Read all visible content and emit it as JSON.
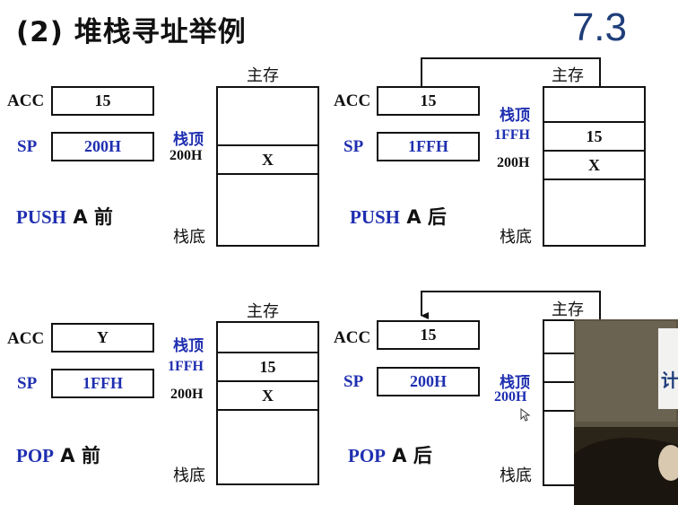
{
  "header": {
    "title": "(2) 堆栈寻址举例",
    "section": "7.3"
  },
  "labels": {
    "acc": "ACC",
    "sp": "SP",
    "main_memory": "主存",
    "stack_top": "栈顶",
    "stack_bottom": "栈底"
  },
  "panels": {
    "push_before": {
      "acc_value": "15",
      "sp_value": "200H",
      "cells": [
        "X"
      ],
      "addresses": [
        "200H"
      ],
      "caption_op": "PUSH",
      "caption_rest": " A 前"
    },
    "push_after": {
      "acc_value": "15",
      "sp_value": "1FFH",
      "cells": [
        "15",
        "X"
      ],
      "addresses": [
        "1FFH",
        "200H"
      ],
      "caption_op": "PUSH",
      "caption_rest": " A 后"
    },
    "pop_before": {
      "acc_value": "Y",
      "sp_value": "1FFH",
      "cells": [
        "15",
        "X"
      ],
      "addresses": [
        "1FFH",
        "200H"
      ],
      "caption_op": "POP",
      "caption_rest": " A 前"
    },
    "pop_after": {
      "acc_value": "15",
      "sp_value": "200H",
      "addresses": [
        "200H"
      ],
      "caption_op": "POP",
      "caption_rest": " A 后"
    }
  },
  "webcam_overlay": {
    "visible_text": "计"
  },
  "colors": {
    "accent_blue": "#1f2fb0",
    "section_blue": "#1f3f7a"
  }
}
